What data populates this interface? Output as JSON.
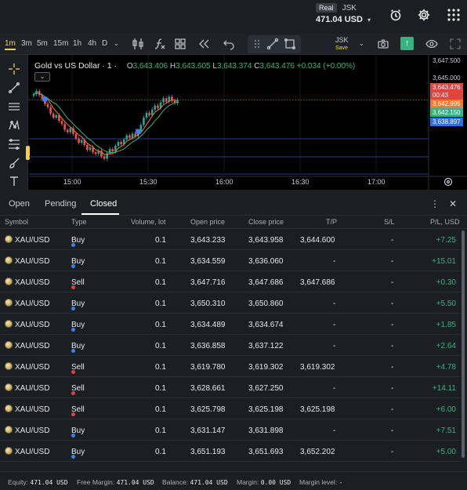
{
  "header": {
    "account_type": "Real",
    "account_name": "JSK",
    "balance": "471.04 USD",
    "icons": [
      "alarm-clock-icon",
      "gear-icon",
      "grid-menu-icon"
    ]
  },
  "toolbar": {
    "timeframes": [
      "1m",
      "3m",
      "5m",
      "15m",
      "1h",
      "4h",
      "D"
    ],
    "active_timeframe": "1m",
    "layout_name": "JSK",
    "layout_status": "Save",
    "colors": {
      "active": "#f2d14b",
      "accent_green": "#36b37e"
    }
  },
  "chart": {
    "symbol_title": "Gold vs US Dollar · 1 ·",
    "ohlc": {
      "o_label": "O",
      "o": "3,643.406",
      "h_label": "H",
      "h": "3,643.605",
      "l_label": "L",
      "l": "3,643.374",
      "c_label": "C",
      "c": "3,643.476",
      "change": "+0.034 (+0.00%)"
    },
    "price_labels": [
      "3,647.500",
      "3,645.000"
    ],
    "price_tags": [
      {
        "text": "3,643.476",
        "color": "#e0443d"
      },
      {
        "text": "00:43",
        "color": "#e0443d"
      },
      {
        "text": "3,642.995",
        "color": "#f07c2a"
      },
      {
        "text": "3,642.150",
        "color": "#36b37e"
      },
      {
        "text": "3,638.897",
        "color": "#2f6fe0"
      }
    ],
    "time_labels": [
      "15:00",
      "15:30",
      "16:00",
      "16:30",
      "17:00"
    ]
  },
  "chart_data": {
    "type": "candlestick",
    "title": "Gold vs US Dollar · 1 ·",
    "ylim": [
      3634.5,
      3648.5
    ],
    "y_tick_labels": [
      "3,647.500",
      "3,645.000"
    ],
    "x_tick_labels": [
      "15:00",
      "15:30",
      "16:00",
      "16:30",
      "17:00"
    ],
    "closes": [
      3644.2,
      3644.6,
      3644.1,
      3643.6,
      3643.0,
      3642.6,
      3641.8,
      3641.3,
      3641.6,
      3640.9,
      3640.5,
      3639.8,
      3639.5,
      3640.0,
      3639.3,
      3638.7,
      3638.2,
      3638.5,
      3637.9,
      3637.3,
      3637.6,
      3637.0,
      3636.8,
      3637.2,
      3636.5,
      3636.2,
      3636.9,
      3637.4,
      3637.1,
      3637.8,
      3638.3,
      3638.0,
      3638.6,
      3639.1,
      3638.8,
      3639.3,
      3639.0,
      3639.6,
      3640.4,
      3641.3,
      3641.9,
      3641.6,
      3642.3,
      3642.8,
      3642.5,
      3643.2,
      3643.7,
      3643.3,
      3643.9,
      3643.4,
      3643.1,
      3643.5
    ],
    "opens": [
      3644.0,
      3644.2,
      3644.6,
      3644.1,
      3643.6,
      3643.0,
      3642.6,
      3641.8,
      3641.3,
      3641.6,
      3640.9,
      3640.5,
      3639.8,
      3639.5,
      3640.0,
      3639.3,
      3638.7,
      3638.2,
      3638.5,
      3637.9,
      3637.3,
      3637.6,
      3637.0,
      3636.8,
      3637.2,
      3636.5,
      3636.2,
      3636.9,
      3637.4,
      3637.1,
      3637.8,
      3638.3,
      3638.0,
      3638.6,
      3639.1,
      3638.8,
      3639.3,
      3639.0,
      3639.6,
      3640.4,
      3641.3,
      3641.9,
      3641.6,
      3642.3,
      3642.8,
      3642.5,
      3643.2,
      3643.7,
      3643.3,
      3643.9,
      3643.4,
      3643.1
    ],
    "sl_line": 3638.897,
    "tp_line": 3647.686
  },
  "orders": {
    "tabs": [
      "Open",
      "Pending",
      "Closed"
    ],
    "active_tab": "Closed",
    "columns": [
      "Symbol",
      "Type",
      "Volume, lot",
      "Open price",
      "Close price",
      "T/P",
      "S/L",
      "P/L, USD"
    ],
    "rows": [
      {
        "symbol": "XAU/USD",
        "type": "Buy",
        "volume": "0.1",
        "open": "3,643.233",
        "close": "3,643.958",
        "tp": "3,644.600",
        "sl": "-",
        "pl": "+7.25"
      },
      {
        "symbol": "XAU/USD",
        "type": "Buy",
        "volume": "0.1",
        "open": "3,634.559",
        "close": "3,636.060",
        "tp": "-",
        "sl": "-",
        "pl": "+15.01"
      },
      {
        "symbol": "XAU/USD",
        "type": "Sell",
        "volume": "0.1",
        "open": "3,647.716",
        "close": "3,647.686",
        "tp": "3,647.686",
        "sl": "-",
        "pl": "+0.30"
      },
      {
        "symbol": "XAU/USD",
        "type": "Buy",
        "volume": "0.1",
        "open": "3,650.310",
        "close": "3,650.860",
        "tp": "-",
        "sl": "-",
        "pl": "+5.50"
      },
      {
        "symbol": "XAU/USD",
        "type": "Buy",
        "volume": "0.1",
        "open": "3,634.489",
        "close": "3,634.674",
        "tp": "-",
        "sl": "-",
        "pl": "+1.85"
      },
      {
        "symbol": "XAU/USD",
        "type": "Buy",
        "volume": "0.1",
        "open": "3,636.858",
        "close": "3,637.122",
        "tp": "-",
        "sl": "-",
        "pl": "+2.64"
      },
      {
        "symbol": "XAU/USD",
        "type": "Sell",
        "volume": "0.1",
        "open": "3,619.780",
        "close": "3,619.302",
        "tp": "3,619.302",
        "sl": "-",
        "pl": "+4.78"
      },
      {
        "symbol": "XAU/USD",
        "type": "Sell",
        "volume": "0.1",
        "open": "3,628.661",
        "close": "3,627.250",
        "tp": "-",
        "sl": "-",
        "pl": "+14.11"
      },
      {
        "symbol": "XAU/USD",
        "type": "Sell",
        "volume": "0.1",
        "open": "3,625.798",
        "close": "3,625.198",
        "tp": "3,625.198",
        "sl": "-",
        "pl": "+6.00"
      },
      {
        "symbol": "XAU/USD",
        "type": "Buy",
        "volume": "0.1",
        "open": "3,631.147",
        "close": "3,631.898",
        "tp": "-",
        "sl": "-",
        "pl": "+7.51"
      },
      {
        "symbol": "XAU/USD",
        "type": "Buy",
        "volume": "0.1",
        "open": "3,651.193",
        "close": "3,651.693",
        "tp": "3,652.202",
        "sl": "-",
        "pl": "+5.00"
      }
    ],
    "type_colors": {
      "Buy": "#3b82f6",
      "Sell": "#e0443d"
    }
  },
  "footer": {
    "equity_label": "Equity:",
    "equity": "471.04 USD",
    "free_margin_label": "Free Margin:",
    "free_margin": "471.04 USD",
    "balance_label": "Balance:",
    "balance": "471.04 USD",
    "margin_label": "Margin:",
    "margin": "0.00 USD",
    "margin_level_label": "Margin level:",
    "margin_level": "-"
  }
}
